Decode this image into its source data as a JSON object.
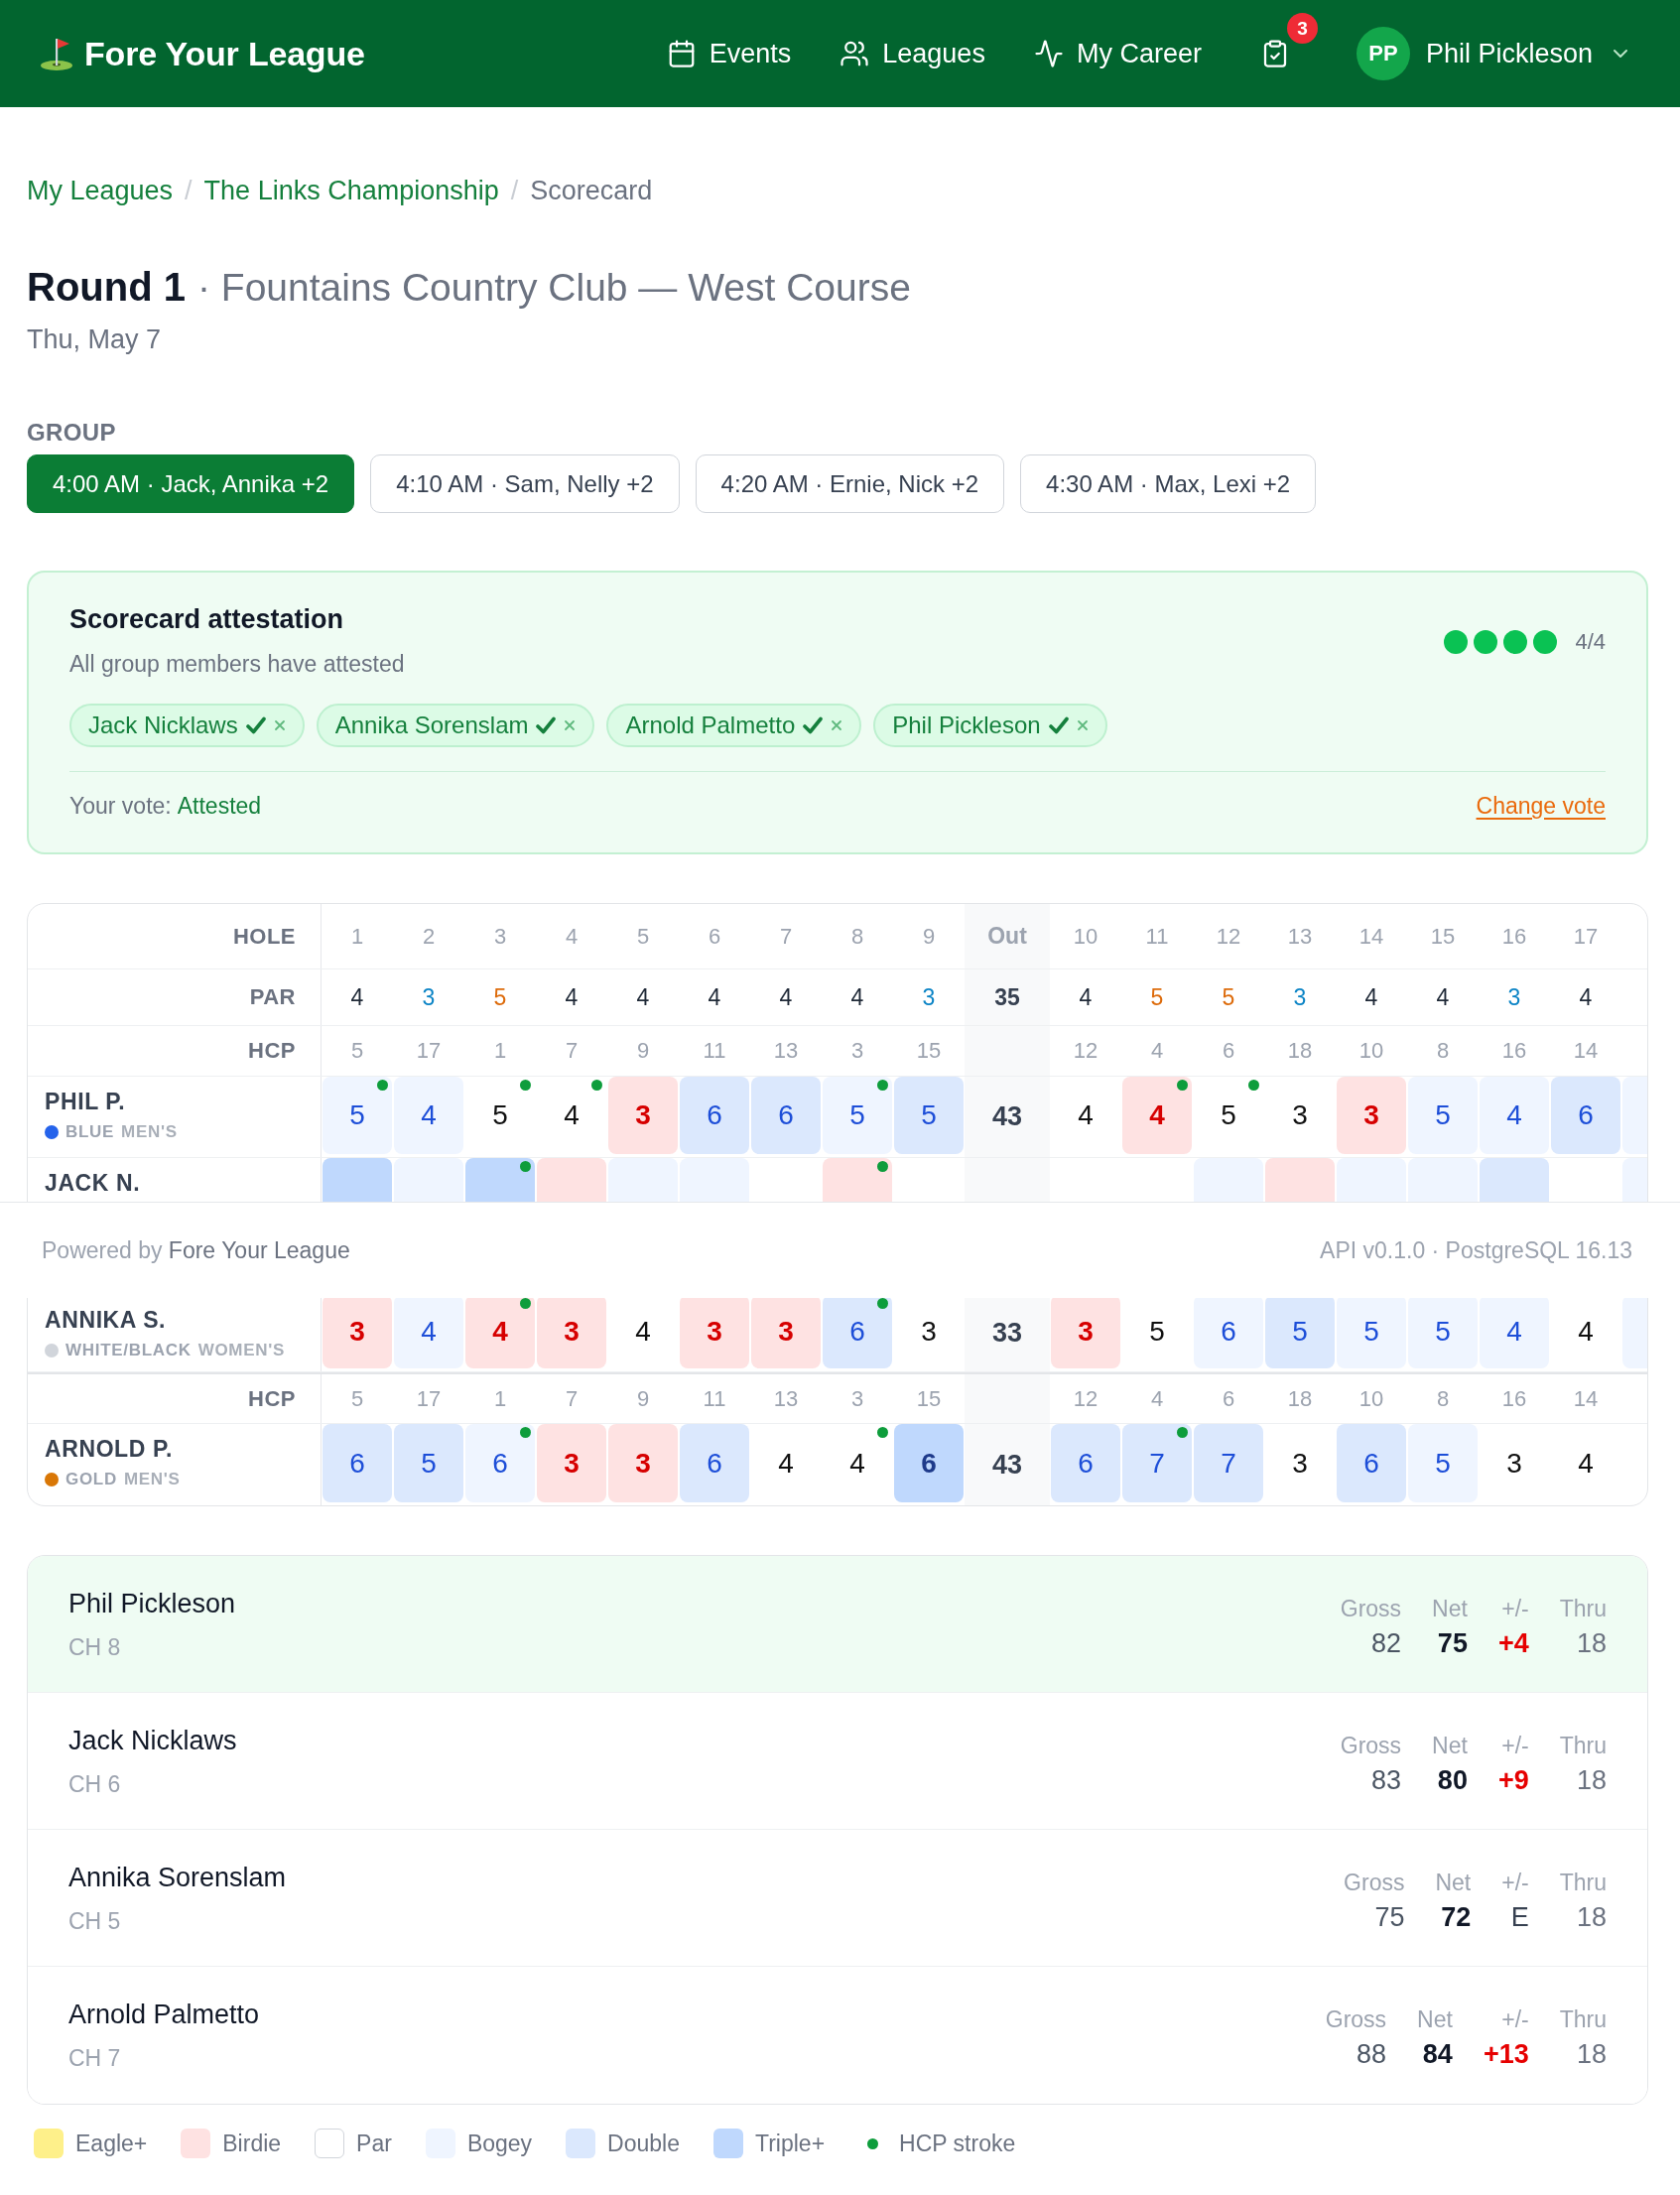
{
  "header": {
    "brand": "Fore Your League",
    "nav": [
      {
        "label": "Events",
        "kind": "calendar"
      },
      {
        "label": "Leagues",
        "kind": "people"
      },
      {
        "label": "My Career",
        "kind": "pulse"
      }
    ],
    "tasks_badge": "3",
    "user": {
      "initials": "PP",
      "name": "Phil Pickleson"
    }
  },
  "breadcrumb": [
    {
      "label": "My Leagues",
      "kind": "link"
    },
    {
      "separator": "/",
      "label": "The Links Championship",
      "kind": "link"
    },
    {
      "separator": "/",
      "label": "Scorecard",
      "kind": "current"
    }
  ],
  "round": {
    "title": "Round 1",
    "course": "· Fountains Country Club — West Course",
    "date": "Thu, May 7"
  },
  "group": {
    "label": "GROUP",
    "tabs": [
      {
        "label": "4:00 AM · Jack, Annika +2",
        "selected": true
      },
      {
        "label": "4:10 AM · Sam, Nelly +2",
        "selected": false
      },
      {
        "label": "4:20 AM · Ernie, Nick +2",
        "selected": false
      },
      {
        "label": "4:30 AM · Max, Lexi +2",
        "selected": false
      }
    ]
  },
  "attestation": {
    "title": "Scorecard attestation",
    "status": "All group members have attested",
    "progress": [
      {
        "attested": true
      },
      {
        "attested": true
      },
      {
        "attested": true
      },
      {
        "attested": true
      }
    ],
    "count": "4/4",
    "members": [
      {
        "name": "Jack Nicklaws",
        "attested": true
      },
      {
        "name": "Annika Sorenslam",
        "attested": true
      },
      {
        "name": "Arnold Palmetto",
        "attested": true
      },
      {
        "name": "Phil Pickleson",
        "attested": true
      }
    ],
    "vote_label": "Your vote:",
    "vote": "Attested",
    "action": "Change vote"
  },
  "scorecard": {
    "sections": [
      {
        "rows": [
          {
            "kind": "hole",
            "label": "HOLE",
            "front": [
              "1",
              "2",
              "3",
              "4",
              "5",
              "6",
              "7",
              "8",
              "9"
            ],
            "out": "Out",
            "back": [
              "10",
              "11",
              "12",
              "13",
              "14",
              "15",
              "16",
              "17"
            ]
          },
          {
            "kind": "par",
            "label": "PAR",
            "front": [
              {
                "value": "4",
                "kind": "four"
              },
              {
                "value": "3",
                "kind": "three"
              },
              {
                "value": "5",
                "kind": "five"
              },
              {
                "value": "4",
                "kind": "four"
              },
              {
                "value": "4",
                "kind": "four"
              },
              {
                "value": "4",
                "kind": "four"
              },
              {
                "value": "4",
                "kind": "four"
              },
              {
                "value": "4",
                "kind": "four"
              },
              {
                "value": "3",
                "kind": "three"
              }
            ],
            "out": "35",
            "back": [
              {
                "value": "4",
                "kind": "four"
              },
              {
                "value": "5",
                "kind": "five"
              },
              {
                "value": "5",
                "kind": "five"
              },
              {
                "value": "3",
                "kind": "three"
              },
              {
                "value": "4",
                "kind": "four"
              },
              {
                "value": "4",
                "kind": "four"
              },
              {
                "value": "3",
                "kind": "three"
              },
              {
                "value": "4",
                "kind": "four"
              }
            ]
          },
          {
            "kind": "hcp",
            "label": "HCP",
            "front": [
              "5",
              "17",
              "1",
              "7",
              "9",
              "11",
              "13",
              "3",
              "15"
            ],
            "back": [
              "12",
              "4",
              "6",
              "18",
              "10",
              "8",
              "16",
              "14"
            ]
          },
          {
            "kind": "player",
            "name": "PHIL P.",
            "tee": {
              "color": "#2563eb",
              "name": "BLUE",
              "gender": "MEN'S"
            },
            "front": [
              {
                "score": "5",
                "kind": "bogey",
                "hcp_stroke": true
              },
              {
                "score": "4",
                "kind": "bogey",
                "hcp_stroke": false
              },
              {
                "score": "5",
                "kind": "par",
                "hcp_stroke": true
              },
              {
                "score": "4",
                "kind": "par",
                "hcp_stroke": true
              },
              {
                "score": "3",
                "kind": "birdie",
                "hcp_stroke": false
              },
              {
                "score": "6",
                "kind": "double",
                "hcp_stroke": false
              },
              {
                "score": "6",
                "kind": "double",
                "hcp_stroke": false
              },
              {
                "score": "5",
                "kind": "bogey",
                "hcp_stroke": true
              },
              {
                "score": "5",
                "kind": "double",
                "hcp_stroke": false
              }
            ],
            "out": "43",
            "back": [
              {
                "score": "4",
                "kind": "par",
                "hcp_stroke": false
              },
              {
                "score": "4",
                "kind": "birdie",
                "hcp_stroke": true
              },
              {
                "score": "5",
                "kind": "par",
                "hcp_stroke": true
              },
              {
                "score": "3",
                "kind": "par",
                "hcp_stroke": false
              },
              {
                "score": "3",
                "kind": "birdie",
                "hcp_stroke": false
              },
              {
                "score": "5",
                "kind": "bogey",
                "hcp_stroke": false
              },
              {
                "score": "4",
                "kind": "bogey",
                "hcp_stroke": false
              },
              {
                "score": "6",
                "kind": "double",
                "hcp_stroke": false
              }
            ],
            "cut_off_cell": {
              "kind": "bogey"
            }
          },
          {
            "kind": "player",
            "name": "JACK N.",
            "front": [
              {
                "kind": "triple",
                "hcp_stroke": false
              },
              {
                "kind": "bogey",
                "hcp_stroke": false
              },
              {
                "kind": "triple",
                "hcp_stroke": true
              },
              {
                "kind": "birdie",
                "hcp_stroke": false
              },
              {
                "kind": "bogey",
                "hcp_stroke": false
              },
              {
                "kind": "bogey",
                "hcp_stroke": false
              },
              {
                "kind": "par",
                "hcp_stroke": false
              },
              {
                "kind": "birdie",
                "hcp_stroke": true
              },
              {
                "kind": "par",
                "hcp_stroke": false
              }
            ],
            "back": [
              {
                "kind": "par",
                "hcp_stroke": false
              },
              {
                "kind": "par",
                "hcp_stroke": false
              },
              {
                "kind": "bogey",
                "hcp_stroke": false
              },
              {
                "kind": "birdie",
                "hcp_stroke": false
              },
              {
                "kind": "bogey",
                "hcp_stroke": false
              },
              {
                "kind": "bogey",
                "hcp_stroke": false
              },
              {
                "kind": "double",
                "hcp_stroke": false
              },
              {
                "kind": "par",
                "hcp_stroke": false
              }
            ],
            "cut_off_cell": {
              "kind": "bogey"
            }
          }
        ]
      },
      {
        "rows": [
          {
            "kind": "player",
            "name": "ANNIKA S.",
            "tee": {
              "color": "#d1d5db",
              "name": "WHITE/BLACK",
              "gender": "WOMEN'S"
            },
            "front": [
              {
                "score": "3",
                "kind": "birdie",
                "hcp_stroke": false
              },
              {
                "score": "4",
                "kind": "bogey",
                "hcp_stroke": false
              },
              {
                "score": "4",
                "kind": "birdie",
                "hcp_stroke": true
              },
              {
                "score": "3",
                "kind": "birdie",
                "hcp_stroke": false
              },
              {
                "score": "4",
                "kind": "par",
                "hcp_stroke": false
              },
              {
                "score": "3",
                "kind": "birdie",
                "hcp_stroke": false
              },
              {
                "score": "3",
                "kind": "birdie",
                "hcp_stroke": false
              },
              {
                "score": "6",
                "kind": "double",
                "hcp_stroke": true
              },
              {
                "score": "3",
                "kind": "par",
                "hcp_stroke": false
              }
            ],
            "out": "33",
            "back": [
              {
                "score": "3",
                "kind": "birdie",
                "hcp_stroke": false
              },
              {
                "score": "5",
                "kind": "par",
                "hcp_stroke": false
              },
              {
                "score": "6",
                "kind": "bogey",
                "hcp_stroke": false
              },
              {
                "score": "5",
                "kind": "double",
                "hcp_stroke": false
              },
              {
                "score": "5",
                "kind": "bogey",
                "hcp_stroke": false
              },
              {
                "score": "5",
                "kind": "bogey",
                "hcp_stroke": false
              },
              {
                "score": "4",
                "kind": "bogey",
                "hcp_stroke": false
              },
              {
                "score": "4",
                "kind": "par",
                "hcp_stroke": false
              }
            ],
            "cut_off_cell": {
              "kind": "bogey"
            }
          },
          {
            "kind": "hcp",
            "label": "HCP",
            "front": [
              "5",
              "17",
              "1",
              "7",
              "9",
              "11",
              "13",
              "3",
              "15"
            ],
            "back": [
              "12",
              "4",
              "6",
              "18",
              "10",
              "8",
              "16",
              "14"
            ]
          },
          {
            "kind": "player",
            "name": "ARNOLD P.",
            "tee": {
              "color": "#d97706",
              "name": "GOLD",
              "gender": "MEN'S"
            },
            "front": [
              {
                "score": "6",
                "kind": "double",
                "hcp_stroke": false
              },
              {
                "score": "5",
                "kind": "double",
                "hcp_stroke": false
              },
              {
                "score": "6",
                "kind": "bogey",
                "hcp_stroke": true
              },
              {
                "score": "3",
                "kind": "birdie",
                "hcp_stroke": false
              },
              {
                "score": "3",
                "kind": "birdie",
                "hcp_stroke": false
              },
              {
                "score": "6",
                "kind": "double",
                "hcp_stroke": false
              },
              {
                "score": "4",
                "kind": "par",
                "hcp_stroke": false
              },
              {
                "score": "4",
                "kind": "par",
                "hcp_stroke": true
              },
              {
                "score": "6",
                "kind": "triple",
                "hcp_stroke": false
              }
            ],
            "out": "43",
            "back": [
              {
                "score": "6",
                "kind": "double",
                "hcp_stroke": false
              },
              {
                "score": "7",
                "kind": "double",
                "hcp_stroke": true
              },
              {
                "score": "7",
                "kind": "double",
                "hcp_stroke": false
              },
              {
                "score": "3",
                "kind": "par",
                "hcp_stroke": false
              },
              {
                "score": "6",
                "kind": "double",
                "hcp_stroke": false
              },
              {
                "score": "5",
                "kind": "bogey",
                "hcp_stroke": false
              },
              {
                "score": "3",
                "kind": "par",
                "hcp_stroke": false
              },
              {
                "score": "4",
                "kind": "par",
                "hcp_stroke": false
              }
            ]
          }
        ]
      }
    ]
  },
  "summary": [
    {
      "name": "Phil Pickleson",
      "handicap": "CH 8",
      "selected": true,
      "stats": [
        {
          "label": "Gross",
          "value": "82",
          "kind": "gross"
        },
        {
          "label": "Net",
          "value": "75",
          "kind": "net"
        },
        {
          "label": "+/-",
          "value": "+4",
          "kind": "over"
        },
        {
          "label": "Thru",
          "value": "18",
          "kind": "thru"
        }
      ]
    },
    {
      "name": "Jack Nicklaws",
      "handicap": "CH 6",
      "selected": false,
      "stats": [
        {
          "label": "Gross",
          "value": "83",
          "kind": "gross"
        },
        {
          "label": "Net",
          "value": "80",
          "kind": "net"
        },
        {
          "label": "+/-",
          "value": "+9",
          "kind": "over"
        },
        {
          "label": "Thru",
          "value": "18",
          "kind": "thru"
        }
      ]
    },
    {
      "name": "Annika Sorenslam",
      "handicap": "CH 5",
      "selected": false,
      "stats": [
        {
          "label": "Gross",
          "value": "75",
          "kind": "gross"
        },
        {
          "label": "Net",
          "value": "72",
          "kind": "net"
        },
        {
          "label": "+/-",
          "value": "E",
          "kind": "even"
        },
        {
          "label": "Thru",
          "value": "18",
          "kind": "thru"
        }
      ]
    },
    {
      "name": "Arnold Palmetto",
      "handicap": "CH 7",
      "selected": false,
      "stats": [
        {
          "label": "Gross",
          "value": "88",
          "kind": "gross"
        },
        {
          "label": "Net",
          "value": "84",
          "kind": "net"
        },
        {
          "label": "+/-",
          "value": "+13",
          "kind": "over"
        },
        {
          "label": "Thru",
          "value": "18",
          "kind": "thru"
        }
      ]
    }
  ],
  "legend": [
    {
      "label": "Eagle+",
      "kind": "eagle"
    },
    {
      "label": "Birdie",
      "kind": "birdie"
    },
    {
      "label": "Par",
      "kind": "par"
    },
    {
      "label": "Bogey",
      "kind": "bogey"
    },
    {
      "label": "Double",
      "kind": "double"
    },
    {
      "label": "Triple+",
      "kind": "triple"
    },
    {
      "label": "HCP stroke",
      "kind": "hcp"
    }
  ],
  "footer": {
    "powered_by": "Powered by",
    "brand": "Fore Your League",
    "version": "API v0.1.0 · PostgreSQL 16.13"
  }
}
